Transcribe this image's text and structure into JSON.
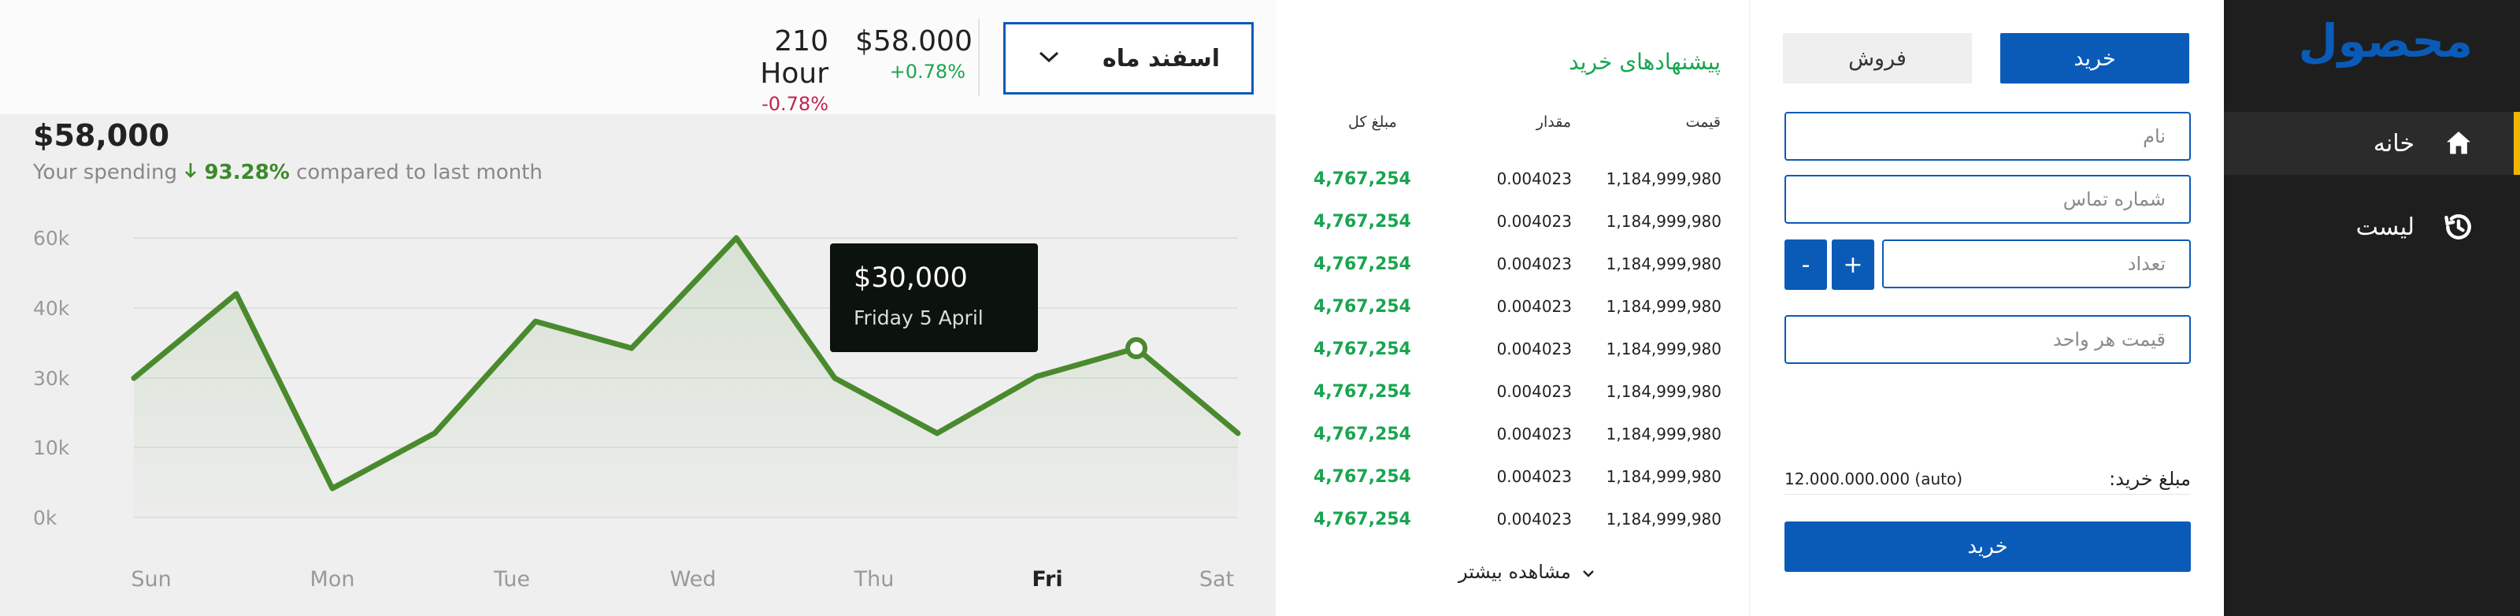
{
  "sidebar": {
    "brand": "محصول",
    "items": [
      {
        "label": "خانه",
        "icon": "home-icon",
        "active": true
      },
      {
        "label": "لیست",
        "icon": "history-icon",
        "active": false
      }
    ]
  },
  "form": {
    "tab_buy": "خرید",
    "tab_sell": "فروش",
    "name_placeholder": "نام",
    "phone_placeholder": "شماره تماس",
    "qty_placeholder": "تعداد",
    "unit_price_placeholder": "قیمت هر واحد",
    "minus": "-",
    "plus": "+",
    "total_label": "مبلغ خرید:",
    "total_value": "12.000.000.000 (auto)",
    "submit": "خرید"
  },
  "orderbook": {
    "title": "پیشنهادهای خرید",
    "headers": {
      "price": "قیمت",
      "amount": "مقدار",
      "total": "مبلغ کل"
    },
    "rows": [
      {
        "price": "1,184,999,980",
        "amount": "0.004023",
        "total": "4,767,254"
      },
      {
        "price": "1,184,999,980",
        "amount": "0.004023",
        "total": "4,767,254"
      },
      {
        "price": "1,184,999,980",
        "amount": "0.004023",
        "total": "4,767,254"
      },
      {
        "price": "1,184,999,980",
        "amount": "0.004023",
        "total": "4,767,254"
      },
      {
        "price": "1,184,999,980",
        "amount": "0.004023",
        "total": "4,767,254"
      },
      {
        "price": "1,184,999,980",
        "amount": "0.004023",
        "total": "4,767,254"
      },
      {
        "price": "1,184,999,980",
        "amount": "0.004023",
        "total": "4,767,254"
      },
      {
        "price": "1,184,999,980",
        "amount": "0.004023",
        "total": "4,767,254"
      },
      {
        "price": "1,184,999,980",
        "amount": "0.004023",
        "total": "4,767,254"
      }
    ],
    "more": "مشاهده بیشتر"
  },
  "header": {
    "month": "اسفند ماه",
    "price_value": "$58.000",
    "price_delta": "+0.78%",
    "hour_value": "210 Hour",
    "hour_delta": "-0.78%",
    "colors": {
      "positive": "#19a550",
      "negative": "#c0254e",
      "accent": "#0a5bb8"
    }
  },
  "spending": {
    "value": "$58,000",
    "prefix": "Your spending",
    "percent": "93.28%",
    "suffix": "compared to last month"
  },
  "chart_data": {
    "type": "line",
    "yticks": [
      "60k",
      "40k",
      "30k",
      "10k",
      "0k"
    ],
    "xticks": [
      "Sun",
      "Mon",
      "Tue",
      "Wed",
      "Thu",
      "Fri",
      "Sat"
    ],
    "active_xtick": "Fri",
    "line_color": "#4a8a2e",
    "tooltip": {
      "value": "$30,000",
      "label": "Friday 5 April",
      "point_index": 10
    }
  }
}
